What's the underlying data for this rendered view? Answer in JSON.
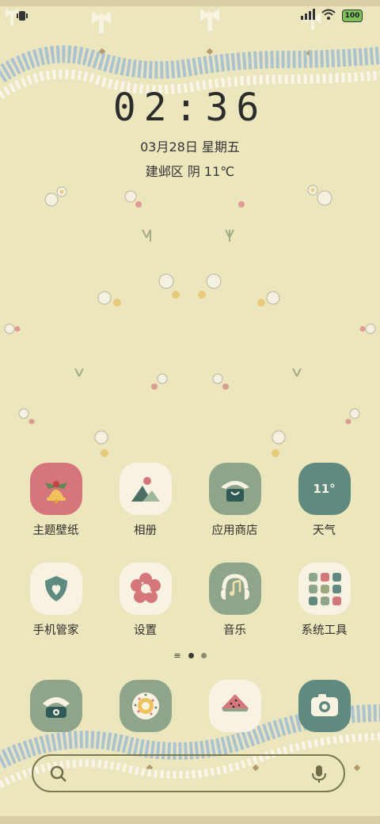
{
  "status": {
    "battery": "100"
  },
  "clock": {
    "time": "02:36",
    "date": "03月28日 星期五",
    "weather": "建邺区 阴 11℃"
  },
  "apps": [
    {
      "label": "主题壁纸",
      "icon": "theme-bell-icon"
    },
    {
      "label": "相册",
      "icon": "gallery-icon"
    },
    {
      "label": "应用商店",
      "icon": "app-store-icon"
    },
    {
      "label": "天气",
      "icon": "weather-icon",
      "value": "11°"
    },
    {
      "label": "手机管家",
      "icon": "phone-manager-icon"
    },
    {
      "label": "设置",
      "icon": "settings-flower-icon"
    },
    {
      "label": "音乐",
      "icon": "music-icon"
    },
    {
      "label": "系统工具",
      "icon": "system-tools-icon"
    }
  ],
  "dock": [
    {
      "icon": "phone-icon"
    },
    {
      "icon": "messages-icon"
    },
    {
      "icon": "browser-icon"
    },
    {
      "icon": "camera-icon"
    }
  ],
  "pager": {
    "pages": 2,
    "active": 1
  },
  "colors": {
    "background": "#ece6bd",
    "icon_green": "#8ea58a",
    "icon_teal": "#5f8a80",
    "icon_pink": "#d6757a",
    "icon_cream": "#f7f2e1"
  }
}
